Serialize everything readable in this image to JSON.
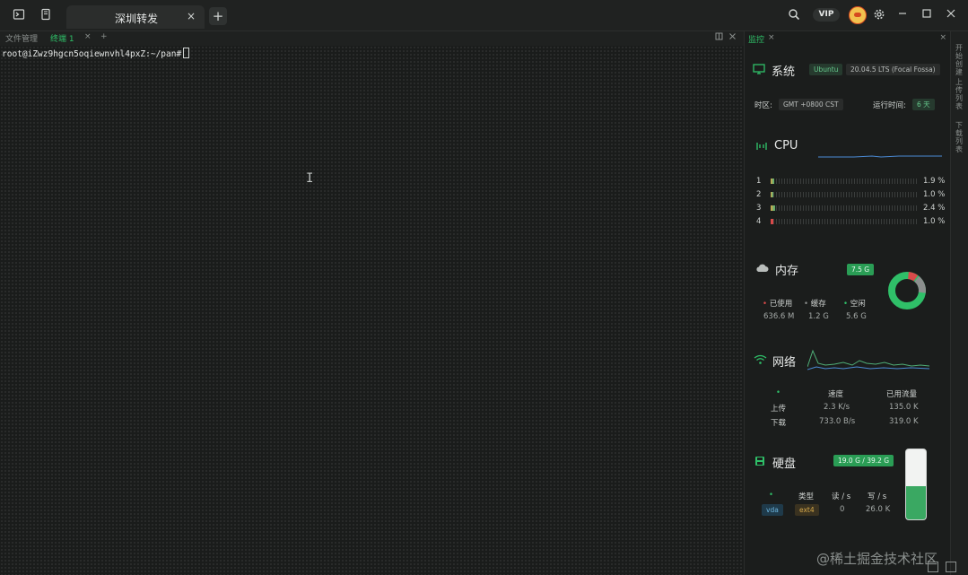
{
  "titlebar": {
    "tab_title": "深圳转发",
    "tab_close": "×",
    "add_tab": "+",
    "vip_label": "VIP",
    "icons": [
      "terminal-icon",
      "book-icon",
      "search-icon",
      "settings-icon"
    ]
  },
  "subtabs": {
    "file_manager": "文件管理",
    "terminal": "终端 1",
    "terminal_close": "×",
    "add": "+"
  },
  "terminal": {
    "prompt": "root@iZwz9hgcn5oqiewnvhl4pxZ:~/pan#"
  },
  "monitor": {
    "tab_label": "监控",
    "tab_close": "×",
    "panel_close": "×",
    "system": {
      "title": "系统",
      "os": "Ubuntu",
      "version": "20.04.5 LTS (Focal Fossa)",
      "timezone_label": "时区:",
      "timezone": "GMT +0800 CST",
      "uptime_label": "运行时间:",
      "uptime": "6 天"
    },
    "cpu": {
      "title": "CPU",
      "cores": [
        {
          "id": "1",
          "percent": "1.9 %",
          "value": 1.9
        },
        {
          "id": "2",
          "percent": "1.0 %",
          "value": 1.0
        },
        {
          "id": "3",
          "percent": "2.4 %",
          "value": 2.4
        },
        {
          "id": "4",
          "percent": "1.0 %",
          "value": 1.0
        }
      ]
    },
    "memory": {
      "title": "内存",
      "total": "7.5 G",
      "used_label": "已使用",
      "cache_label": "缓存",
      "free_label": "空闲",
      "used": "636.6 M",
      "cache": "1.2 G",
      "free": "5.6 G"
    },
    "network": {
      "title": "网络",
      "col_speed": "速度",
      "col_used": "已用流量",
      "upload_label": "上传",
      "upload_speed": "2.3 K/s",
      "upload_used": "135.0 K",
      "download_label": "下载",
      "download_speed": "733.0 B/s",
      "download_used": "319.0 K"
    },
    "disk": {
      "title": "硬盘",
      "usage": "19.0 G / 39.2 G",
      "col_type": "类型",
      "col_read": "读 / s",
      "col_write": "写 / s",
      "device": "vda",
      "fs_type": "ext4",
      "read": "0",
      "write": "26.0 K",
      "used_fraction": 0.48
    }
  },
  "side_strip": {
    "items": [
      "开始创建",
      "上传列表",
      "下载列表"
    ]
  },
  "watermark": "@稀土掘金技术社区",
  "colors": {
    "accent": "#2fbf68",
    "mem_used": "#d94a4a",
    "mem_cache": "#8c8f8e",
    "mem_free": "#2fbf68",
    "net_up": "#4fae77",
    "net_down": "#4b8bd6"
  }
}
